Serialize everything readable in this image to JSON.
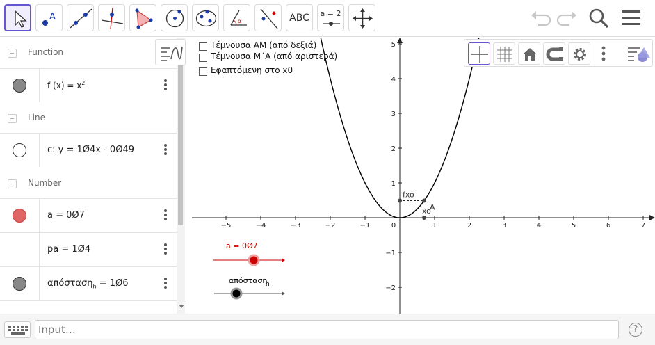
{
  "toolbar": {
    "tools": [
      {
        "name": "move-tool-icon",
        "selected": true
      },
      {
        "name": "point-tool-icon"
      },
      {
        "name": "line-tool-icon"
      },
      {
        "name": "perpendicular-line-tool-icon"
      },
      {
        "name": "polygon-tool-icon"
      },
      {
        "name": "circle-tool-icon"
      },
      {
        "name": "ellipse-tool-icon"
      },
      {
        "name": "angle-tool-icon"
      },
      {
        "name": "reflect-tool-icon"
      },
      {
        "name": "text-tool-icon",
        "text": "ABC"
      },
      {
        "name": "slider-tool-icon",
        "text": "a = 2"
      },
      {
        "name": "move-graphics-view-tool-icon"
      }
    ],
    "right_icons": [
      "undo-icon",
      "redo-icon",
      "search-icon",
      "menu-icon"
    ]
  },
  "algebra": {
    "categories": {
      "function": "Function",
      "line": "Line",
      "number": "Number"
    },
    "items": {
      "f": {
        "name_html": "f (x) = x",
        "sup": "2",
        "marble": "#888888"
      },
      "c": {
        "text": "c: y = 1Ø4x - 0Ø49",
        "marble": "#ffffff"
      },
      "a": {
        "text": "a = 0Ø7",
        "marble": "#e06666"
      },
      "pa": {
        "text": "pa = 1Ø4"
      },
      "apostasi": {
        "main": "απόσταση",
        "sub": "h",
        "rest": " = 1Ø6",
        "marble": "#888888"
      }
    }
  },
  "graphics": {
    "checkboxes": [
      "Τέμνουσα ΑΜ (από δεξιά)",
      "Τέμνουσα Μ΄Α (από αριστερά)",
      "Εφαπτόμενη στο x0"
    ],
    "x_ticks": [
      "−5",
      "−4",
      "−3",
      "−2",
      "−1",
      "0",
      "1",
      "2",
      "3",
      "4",
      "5",
      "6",
      "7"
    ],
    "y_ticks": [
      "5",
      "4",
      "3",
      "2",
      "1",
      "−1",
      "−2"
    ],
    "labels": {
      "fxo": "fxo",
      "xo": "xo",
      "A": "A"
    },
    "sliders": {
      "a_label": "a = 0Ø7",
      "h_label_main": "απόσταση",
      "h_label_sub": "h",
      "a_value": 0.7,
      "h_value": 1.6
    },
    "colors": {
      "slider_a": "#cc0000",
      "slider_h": "#000000"
    },
    "style_bar_icons": [
      "axes-icon",
      "grid-icon",
      "home-icon",
      "magnet-icon",
      "settings-icon",
      "more-icon",
      "style-bar-toggle-icon"
    ]
  },
  "input": {
    "placeholder": "Input…"
  }
}
